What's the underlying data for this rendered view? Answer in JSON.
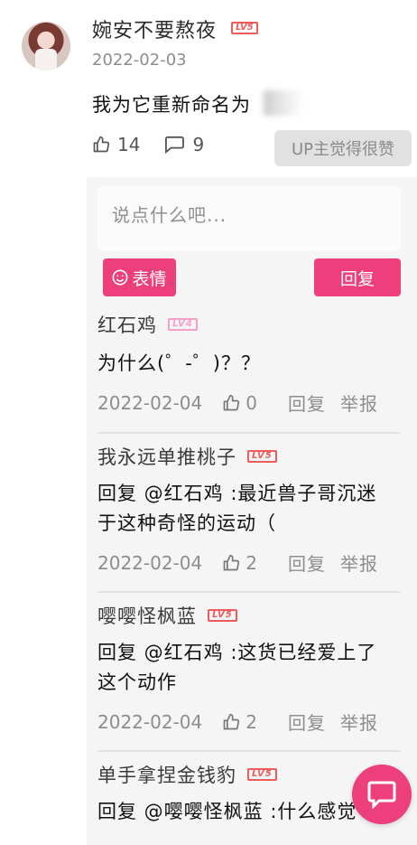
{
  "comment": {
    "username": "婉安不要熬夜",
    "level": "LV5",
    "date": "2022-02-03",
    "text": "我为它重新命名为",
    "likes": "14",
    "replies": "9",
    "up_liked_label": "UP主觉得很赞"
  },
  "reply_box": {
    "placeholder": "说点什么吧...",
    "emoji_label": "表情",
    "submit_label": "回复"
  },
  "replies": [
    {
      "name": "红石鸡",
      "level": "LV4",
      "text": "为什么(゜-゜)？？",
      "date": "2022-02-04",
      "likes": "0",
      "reply": "回复",
      "report": "举报"
    },
    {
      "name": "我永远单推桃子",
      "level": "LV5",
      "text_line1": "回复 @红石鸡 :最近兽子哥沉迷",
      "text_line2": "于这种奇怪的运动（",
      "date": "2022-02-04",
      "likes": "2",
      "reply": "回复",
      "report": "举报"
    },
    {
      "name": "嘤嘤怪枫蓝",
      "level": "LV5",
      "text_line1": "回复 @红石鸡 :这货已经爱上了",
      "text_line2": "这个动作",
      "date": "2022-02-04",
      "likes": "2",
      "reply": "回复",
      "report": "举报"
    },
    {
      "name": "单手拿捏金钱豹",
      "level": "LV5",
      "text": "回复 @嘤嘤怪枫蓝 :什么感觉"
    }
  ],
  "colors": {
    "accent": "#ec3f7c",
    "lv5": "#ef5a5a",
    "lv4": "#f6a0c8"
  }
}
